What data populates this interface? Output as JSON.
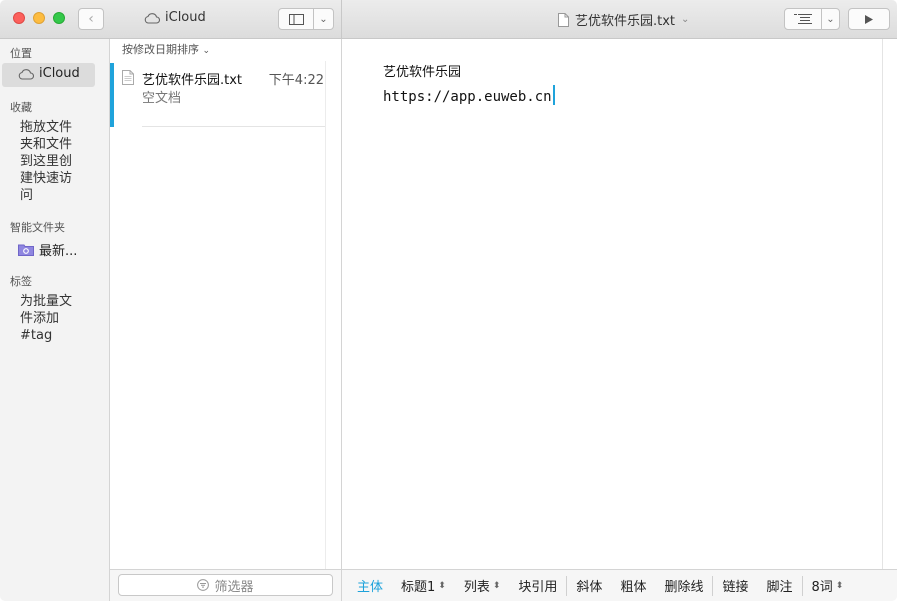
{
  "window": {
    "left_title": "iCloud",
    "doc_title": "艺优软件乐园.txt"
  },
  "sidebar": {
    "location_header": "位置",
    "icloud_label": "iCloud",
    "favorites_header": "收藏",
    "favorites_hint": [
      "拖放文件",
      "夹和文件",
      "到这里创",
      "建快速访",
      "问"
    ],
    "smart_header": "智能文件夹",
    "recent_label": "最新...",
    "tags_header": "标签",
    "tags_hint": [
      "为批量文",
      "件添加",
      "#tag"
    ]
  },
  "filelist": {
    "sort_label": "按修改日期排序",
    "files": [
      {
        "name": "艺优软件乐园.txt",
        "time": "下午4:22",
        "summary": "空文档"
      }
    ],
    "filter_placeholder": "筛选器"
  },
  "editor": {
    "lines": [
      "艺优软件乐园",
      "https://app.euweb.cn"
    ]
  },
  "format_bar": {
    "body": "主体",
    "heading": "标题1",
    "list": "列表",
    "blockquote": "块引用",
    "italic": "斜体",
    "bold": "粗体",
    "strikethrough": "删除线",
    "link": "链接",
    "footnote": "脚注",
    "word_count": "8词"
  },
  "colors": {
    "accent": "#1fa3db",
    "close": "#fc605c",
    "minimize": "#fdbc40",
    "maximize": "#34c84a"
  }
}
